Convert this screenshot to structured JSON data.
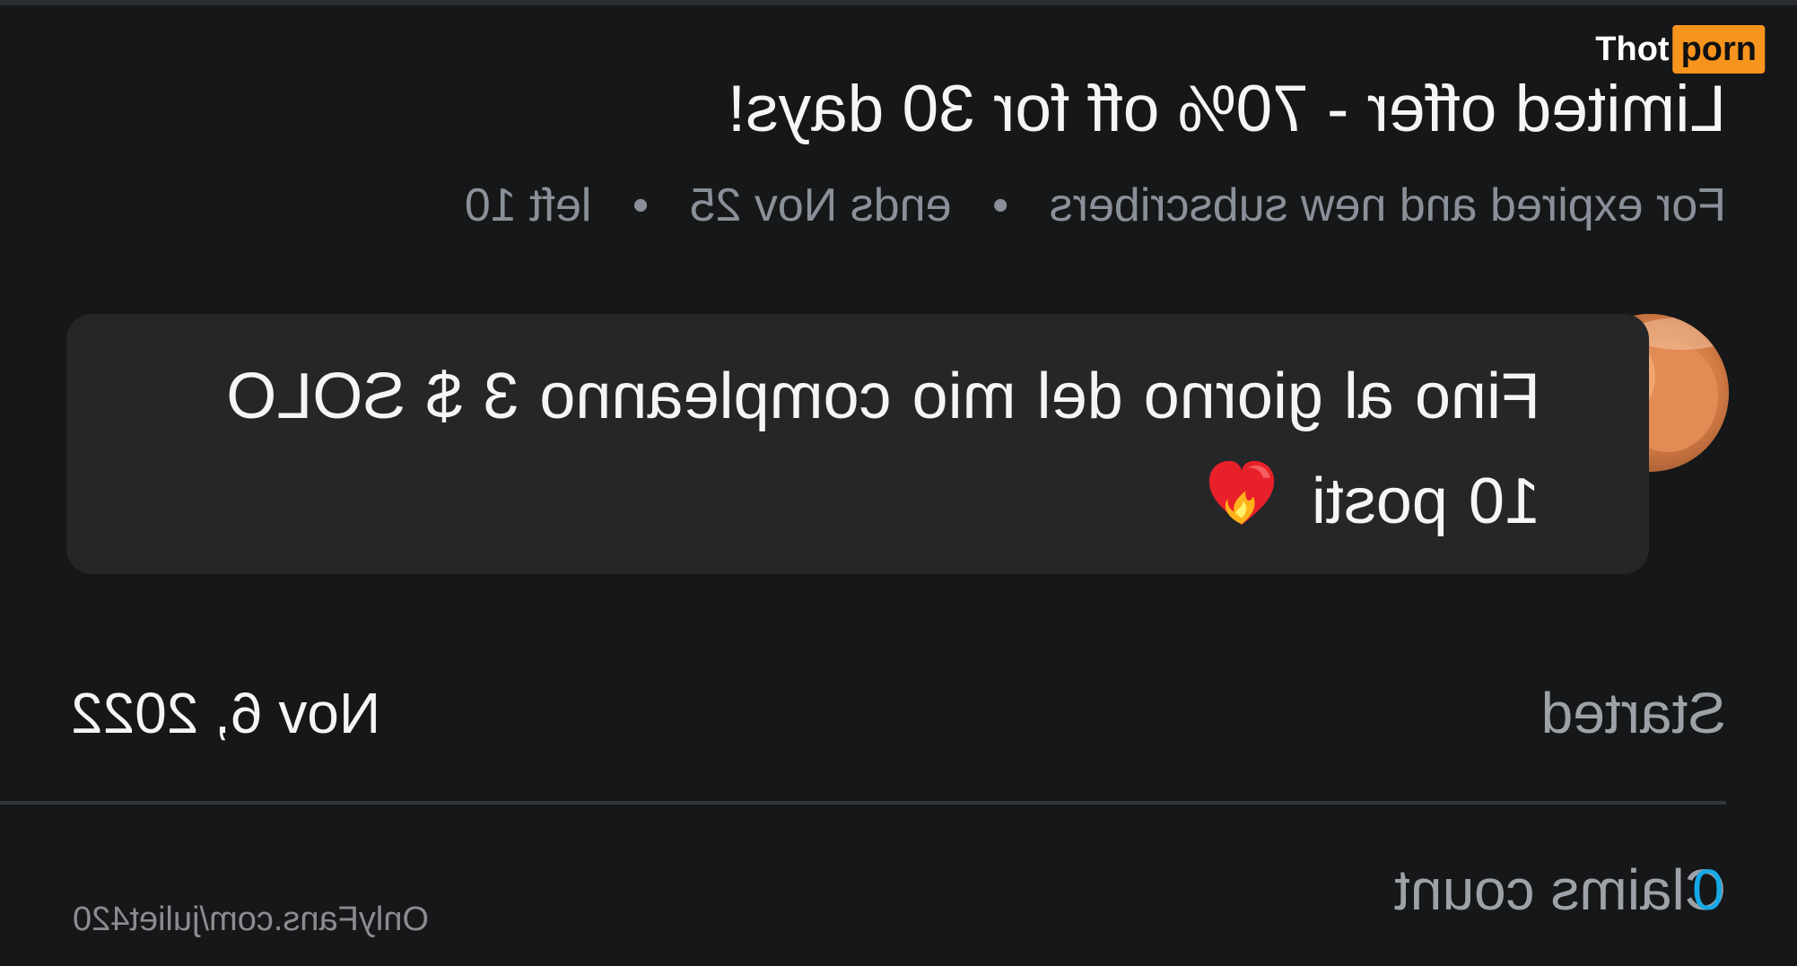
{
  "offer": {
    "title": "Limited offer - 70% off for 30 days!",
    "audience": "For expired and new subscribers",
    "ends": "ends Nov 25",
    "left": "left 10"
  },
  "message": {
    "text": "Fino al giorno del mio compleanno 3 $ SOLO 10 posti",
    "emoji_icon": "heart-on-fire-icon"
  },
  "details": {
    "started_label": "Started",
    "started_value": "Nov 6, 2022",
    "claims_label": "Claims count",
    "claims_value": "0"
  },
  "watermarks": {
    "brand_part1": "Thot",
    "brand_part2": "porn",
    "site": "OnlyFans.com/juliet420"
  },
  "colors": {
    "background": "#161718",
    "card": "#242628",
    "muted_text": "#8a9099",
    "accent_blue": "#17a9e6",
    "brand_orange": "#f7941d"
  }
}
